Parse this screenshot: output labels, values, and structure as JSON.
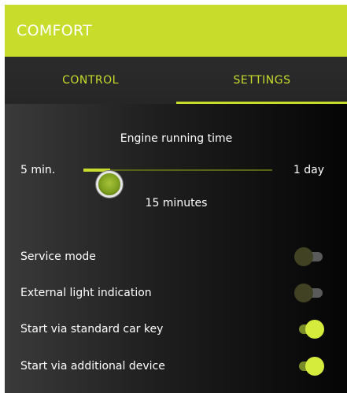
{
  "header": {
    "title": "COMFORT"
  },
  "tabs": [
    {
      "label": "CONTROL",
      "active": false
    },
    {
      "label": "SETTINGS",
      "active": true
    }
  ],
  "engine": {
    "title": "Engine running time",
    "min_label": "5 min.",
    "max_label": "1 day",
    "value_label": "15 minutes",
    "slider_fraction": 0.14
  },
  "settings": [
    {
      "label": "Service mode",
      "enabled": false
    },
    {
      "label": "External light indication",
      "enabled": false
    },
    {
      "label": "Start via standard car key",
      "enabled": true
    },
    {
      "label": "Start via additional device",
      "enabled": true
    }
  ],
  "colors": {
    "accent": "#c8dc2c",
    "background": "#0b0b0b",
    "tab_bar": "#282828"
  }
}
